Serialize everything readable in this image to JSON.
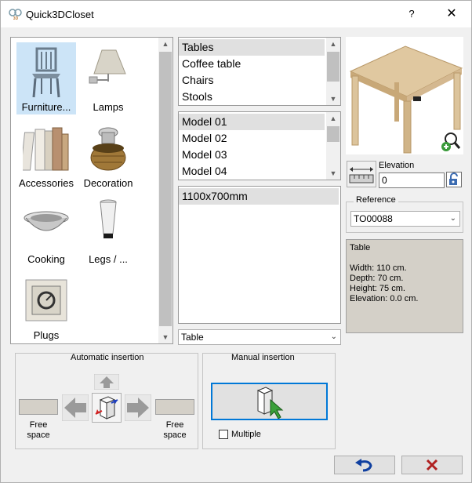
{
  "window": {
    "title": "Quick3DCloset",
    "app_icon_text": "QC\n3D",
    "help": "?",
    "close": "✕"
  },
  "categories": [
    {
      "label": "Furniture...",
      "icon": "chair-icon",
      "selected": true
    },
    {
      "label": "Lamps",
      "icon": "lamp-icon"
    },
    {
      "label": "Accessories",
      "icon": "books-icon"
    },
    {
      "label": "Decoration",
      "icon": "basket-icon"
    },
    {
      "label": "Cooking",
      "icon": "wok-icon"
    },
    {
      "label": "Legs / ...",
      "icon": "leg-icon"
    },
    {
      "label": "Plugs",
      "icon": "plug-icon"
    }
  ],
  "types": {
    "items": [
      "Tables",
      "Coffee table",
      "Chairs",
      "Stools"
    ],
    "selected": "Tables"
  },
  "models": {
    "items": [
      "Model 01",
      "Model 02",
      "Model 03",
      "Model 04"
    ],
    "selected": "Model 01"
  },
  "sizes": {
    "items": [
      "1100x700mm"
    ],
    "selected": "1100x700mm"
  },
  "type_combo": {
    "value": "Table"
  },
  "elevation": {
    "label": "Elevation",
    "value": "0"
  },
  "reference": {
    "title": "Reference",
    "value": "TO00088"
  },
  "info": {
    "name": "Table",
    "width": "Width: 110 cm.",
    "depth": "Depth: 70 cm.",
    "height": "Height: 75 cm.",
    "elevation": "Elevation: 0.0 cm."
  },
  "auto_insertion": {
    "title": "Automatic insertion",
    "free_left": "Free\nspace",
    "free_right": "Free\nspace"
  },
  "manual_insertion": {
    "title": "Manual insertion",
    "multiple_label": "Multiple",
    "multiple_checked": false
  },
  "footer": {
    "undo_icon": "undo-icon",
    "cancel_icon": "cancel-x-icon"
  },
  "colors": {
    "selection": "#cce4f7",
    "list_selection": "#e0e0e0",
    "info_bg": "#d4d0c8",
    "manual_border": "#0078d7",
    "cancel": "#b02020",
    "undo": "#1040a0"
  }
}
